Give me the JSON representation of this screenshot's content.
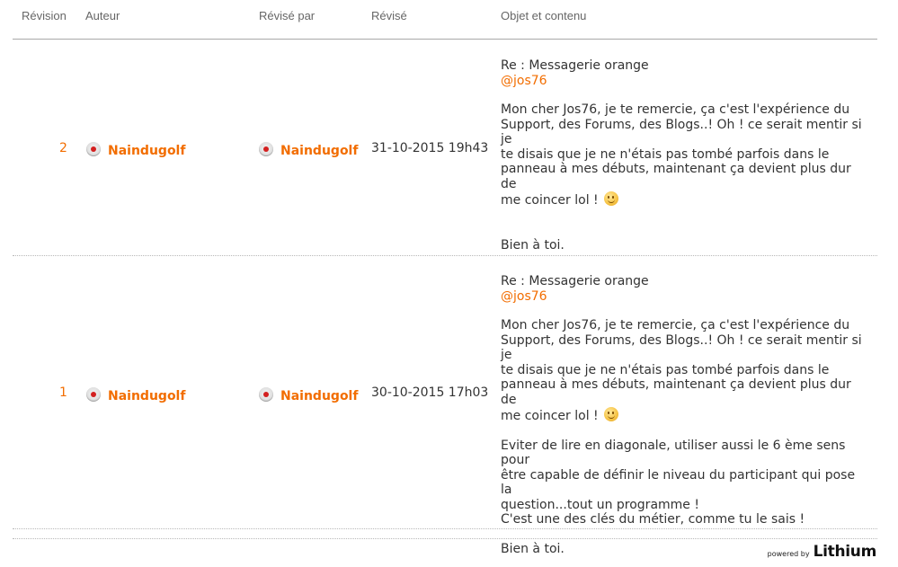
{
  "headers": {
    "revision": "Révision",
    "author": "Auteur",
    "revised_by": "Révisé par",
    "revised": "Révisé",
    "subject_content": "Objet et contenu"
  },
  "rows": [
    {
      "revision": "2",
      "author": "Naindugolf",
      "revised_by": "Naindugolf",
      "date": "31-10-2015 19h43",
      "subject": "Re : Messagerie orange",
      "mention": "@jos76",
      "para1_l1": "Mon cher Jos76, je te remercie, ça c'est l'expérience du",
      "para1_l2": "Support, des Forums, des Blogs..! Oh ! ce serait mentir si je",
      "para1_l3": "te disais que je ne n'étais pas tombé parfois dans le",
      "para1_l4": "panneau à mes débuts, maintenant ça devient plus dur de",
      "para1_l5": "me coincer lol !",
      "closing": "Bien à toi."
    },
    {
      "revision": "1",
      "author": "Naindugolf",
      "revised_by": "Naindugolf",
      "date": "30-10-2015 17h03",
      "subject": "Re : Messagerie orange",
      "mention": "@jos76",
      "para1_l1": "Mon cher Jos76, je te remercie, ça c'est l'expérience du",
      "para1_l2": "Support, des Forums, des Blogs..! Oh ! ce serait mentir si je",
      "para1_l3": "te disais que je ne n'étais pas tombé parfois dans le",
      "para1_l4": "panneau à mes débuts, maintenant ça devient plus dur de",
      "para1_l5": "me coincer lol !",
      "para2_l1": "Eviter de lire en diagonale, utiliser aussi le 6 ème sens pour",
      "para2_l2": "être capable de définir le niveau du participant qui pose la",
      "para2_l3": "question...tout un programme !",
      "para2_l4": "C'est une des clés du métier, comme tu le sais !",
      "closing": "Bien à toi."
    }
  ],
  "footer": {
    "powered_by": "powered by",
    "brand": "Lithium"
  },
  "colors": {
    "accent": "#f26d00",
    "text": "#333333",
    "header_text": "#666666"
  },
  "icons": {
    "status": "offline-status-icon",
    "smiley": "smiley-icon"
  }
}
